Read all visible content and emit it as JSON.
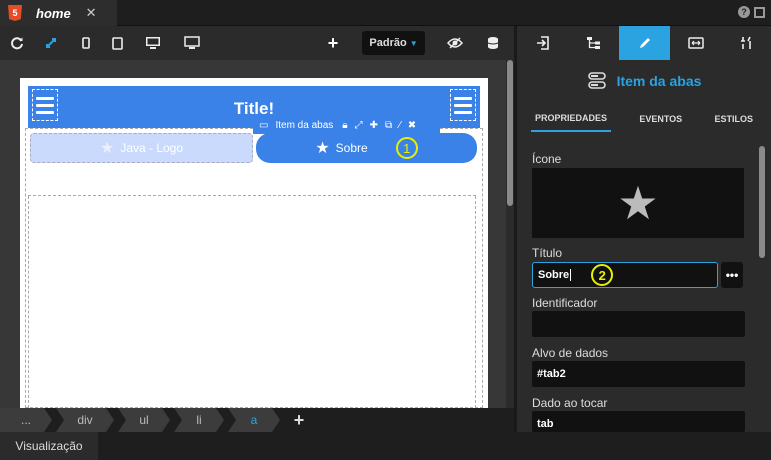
{
  "tabbar": {
    "file_badge": "5",
    "file_tab": "home",
    "close": "✕",
    "help": "?"
  },
  "toolbar": {
    "theme": "Padrão",
    "add": "+"
  },
  "canvas": {
    "header_title": "Title!",
    "tab_items": [
      {
        "label": "Java - Logo"
      },
      {
        "label": "Sobre"
      }
    ],
    "floating_toolbar_label": "Item da abas",
    "badge1": "1"
  },
  "breadcrumb": [
    "...",
    "div",
    "ul",
    "li",
    "a"
  ],
  "bottom": {
    "tab": "Visualização"
  },
  "right_panel": {
    "component_name": "Item da abas",
    "subtabs": [
      "PROPRIEDADES",
      "EVENTOS",
      "ESTILOS"
    ],
    "fields": {
      "icon_label": "Ícone",
      "title_label": "Título",
      "title_value": "Sobre",
      "title_badge": "2",
      "more": "•••",
      "id_label": "Identificador",
      "id_value": "",
      "target_label": "Alvo de dados",
      "target_value": "#tab2",
      "toggle_label": "Dado ao tocar",
      "toggle_value": "tab"
    }
  },
  "colors": {
    "accent": "#2aa3e0",
    "brand_blue": "#3a82e8",
    "badge_yellow": "#e8f000"
  }
}
